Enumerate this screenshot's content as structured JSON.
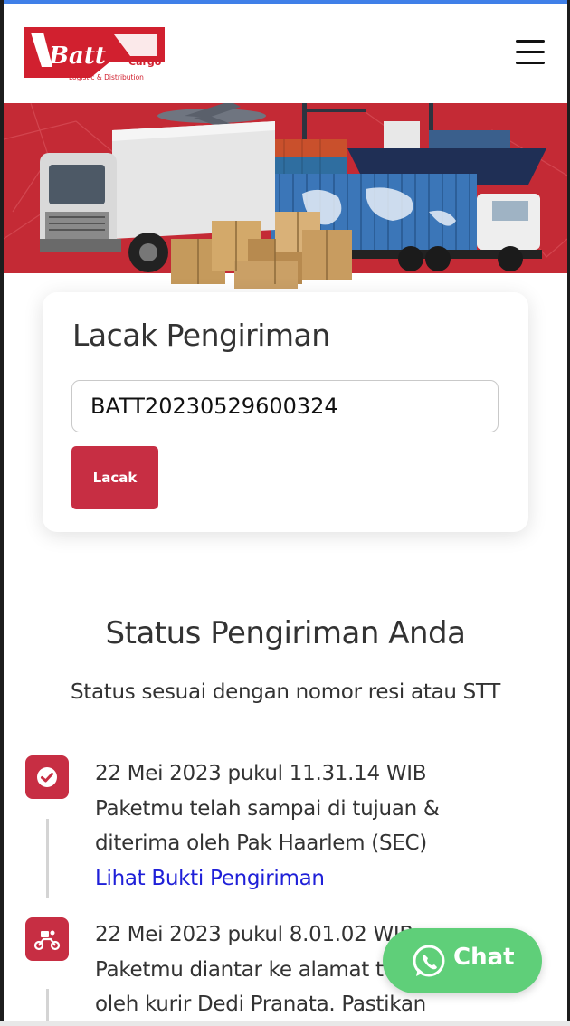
{
  "header": {
    "logo": {
      "brand": "Batt",
      "suffix": "Cargo",
      "tagline": "Logistic & Distribution"
    },
    "menu_icon": "hamburger-menu-icon"
  },
  "banner": {
    "description_icons": [
      "truck",
      "cargo-ship",
      "airplane",
      "containers",
      "boxes",
      "container-truck"
    ]
  },
  "tracking_card": {
    "title": "Lacak Pengiriman",
    "input_value": "BATT20230529600324",
    "button_label": "Lacak"
  },
  "status": {
    "title": "Status Pengiriman Anda",
    "subtitle": "Status sesuai dengan nomor resi atau STT",
    "events": [
      {
        "icon": "check-circle-icon",
        "timestamp": "22 Mei 2023 pukul 11.31.14 WIB",
        "line1": "Paketmu telah sampai di tujuan &",
        "line2": "diterima oleh Pak Haarlem (SEC)",
        "link": "Lihat Bukti Pengiriman"
      },
      {
        "icon": "courier-scooter-icon",
        "timestamp": "22 Mei 2023 pukul 8.01.02 WIB",
        "line1": "Paketmu diantar ke alamat tujuan",
        "line2": "oleh kurir Dedi Pranata. Pastikan"
      }
    ]
  },
  "chat": {
    "label": "Chat",
    "icon": "whatsapp-icon"
  },
  "colors": {
    "brand_red": "#c72e43",
    "chat_green": "#5fcf79",
    "link_blue": "#1f20d8",
    "top_accent": "#3f7fe8"
  }
}
